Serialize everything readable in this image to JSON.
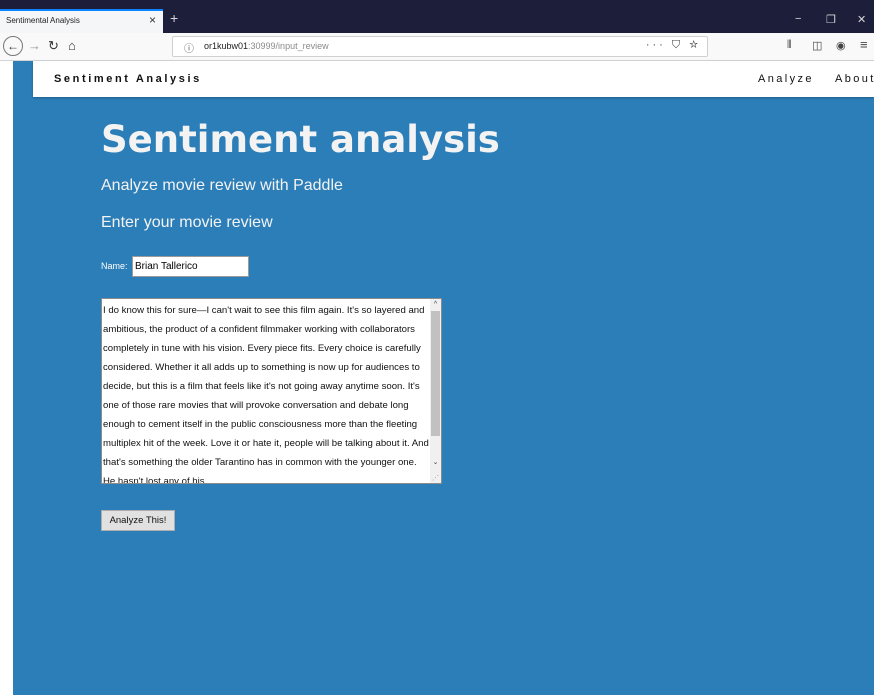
{
  "browser": {
    "tab_title": "Sentimental Analysis",
    "tab_close": "×",
    "new_tab": "+",
    "url_host": "or1kubw01",
    "url_path": ":30999/input_review",
    "page_actions": "··· ⛉ ☆",
    "icons": {
      "back": "←",
      "forward": "→",
      "reload": "↻",
      "home": "⌂",
      "info": "ⓘ",
      "library": "⫴",
      "sidebar": "◫",
      "account": "◉",
      "menu": "≡",
      "minimize": "−",
      "restore": "❐",
      "close": "✕"
    }
  },
  "site": {
    "brand": "Sentiment Analysis",
    "nav_links": [
      "Analyze",
      "About"
    ]
  },
  "hero": {
    "title": "Sentiment analysis",
    "subtitle": "Analyze movie review with Paddle"
  },
  "form": {
    "section_title": "Enter your movie review",
    "name_label": "Name:",
    "name_value": "Brian Tallerico",
    "review_text": "I do know this for sure—I can't wait to see this film again. It's so layered and ambitious, the product of a confident filmmaker working with collaborators completely in tune with his vision. Every piece fits. Every choice is carefully considered. Whether it all adds up to something is now up for audiences to decide, but this is a film that feels like it's not going away anytime soon. It's one of those rare movies that will provoke conversation and debate long enough to cement itself in the public consciousness more than the fleeting multiplex hit of the week. Love it or hate it, people will be talking about it. And that's something the older Tarantino has in common with the younger one. He hasn't lost any of his",
    "submit_label": "Analyze This!",
    "scroll_up": "^",
    "scroll_down": "⌄",
    "resize": "⋰"
  },
  "colors": {
    "page_background": "#2c7eb8",
    "tab_strip": "#1d1f3a",
    "active_tab_accent": "#0a84ff"
  }
}
